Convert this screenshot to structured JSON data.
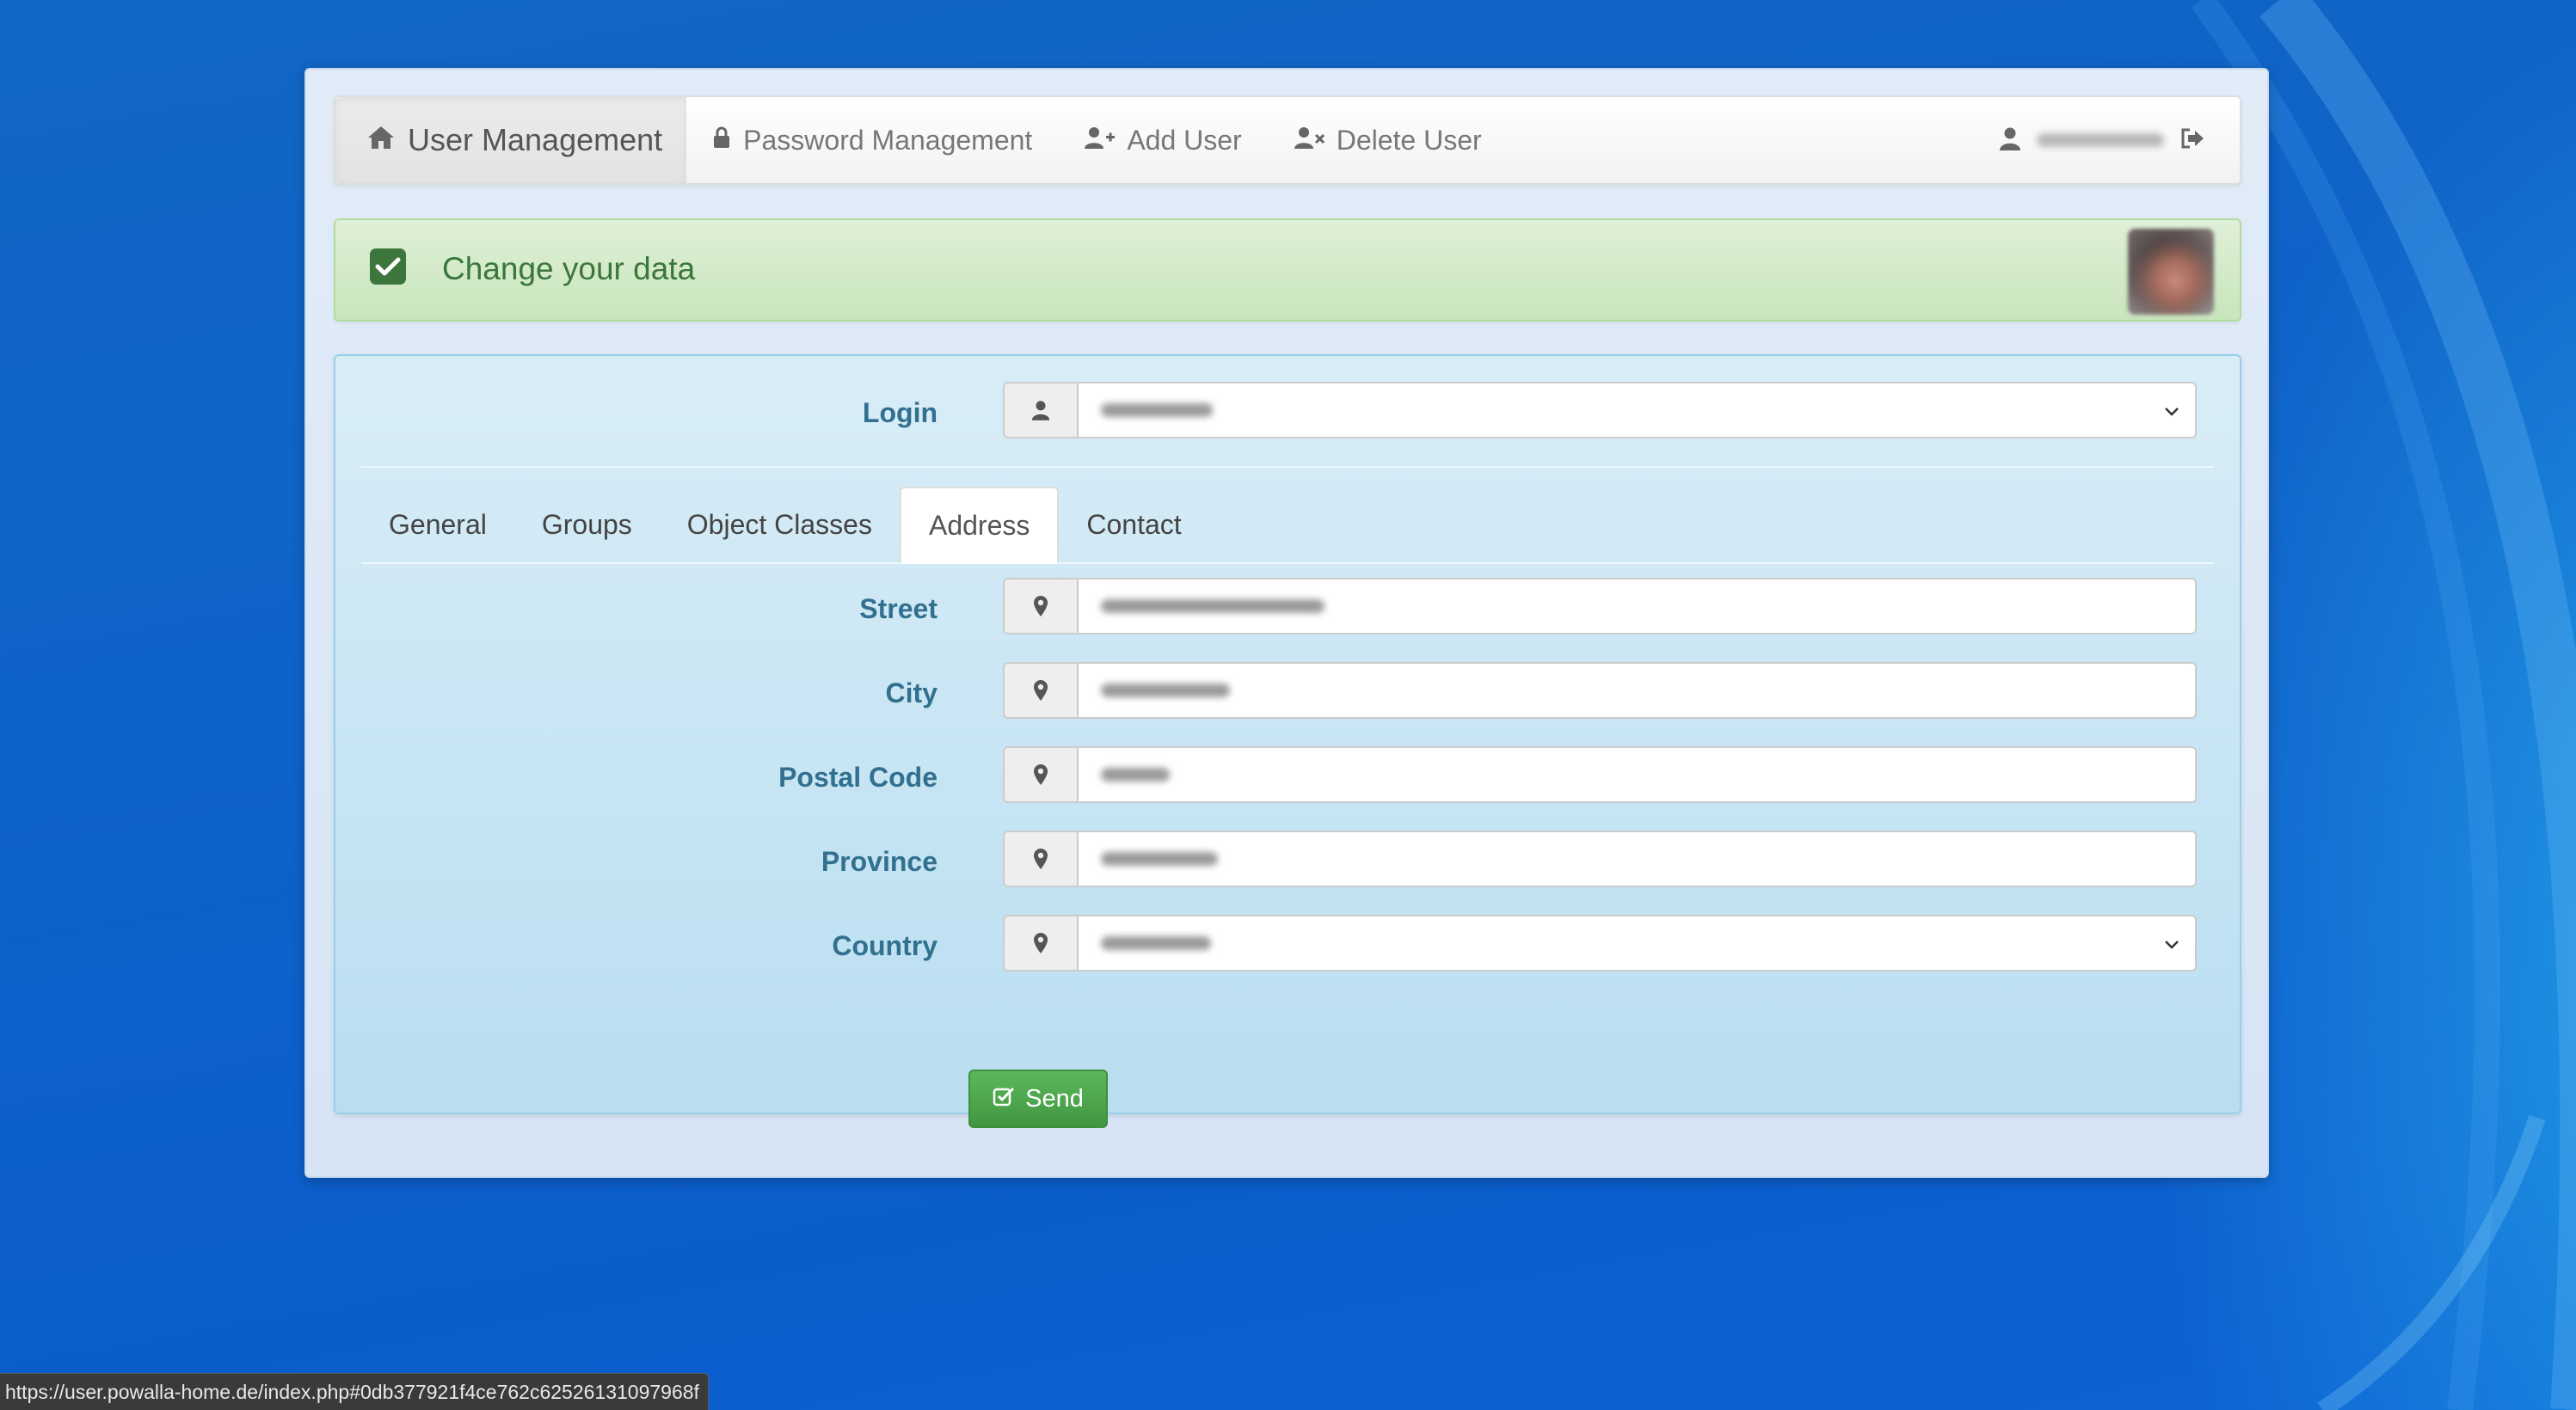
{
  "navbar": {
    "brand_label": "User Management",
    "items": [
      {
        "label": "Password Management",
        "icon": "lock-icon"
      },
      {
        "label": "Add User",
        "icon": "user-plus-icon"
      },
      {
        "label": "Delete User",
        "icon": "user-times-icon"
      }
    ],
    "brand_icon": "home-icon",
    "user_icon": "user-icon",
    "logout_icon": "logout-icon"
  },
  "alert": {
    "text": "Change your data",
    "icon": "check-square-icon"
  },
  "form": {
    "login_label": "Login",
    "tabs": [
      {
        "label": "General",
        "active": false
      },
      {
        "label": "Groups",
        "active": false
      },
      {
        "label": "Object Classes",
        "active": false
      },
      {
        "label": "Address",
        "active": true
      },
      {
        "label": "Contact",
        "active": false
      }
    ],
    "fields": [
      {
        "label": "Street",
        "type": "text"
      },
      {
        "label": "City",
        "type": "text"
      },
      {
        "label": "Postal Code",
        "type": "text"
      },
      {
        "label": "Province",
        "type": "text"
      },
      {
        "label": "Country",
        "type": "select"
      }
    ],
    "field_icon": "map-marker-icon",
    "send_label": "Send"
  },
  "statusbar": {
    "url": "https://user.powalla-home.de/index.php#0db377921f4ce762c62526131097968f"
  },
  "colors": {
    "desktop": "#0e66cc",
    "alert_text": "#3c763d",
    "label_text": "#31708f",
    "send_button": "#5cb85c"
  }
}
